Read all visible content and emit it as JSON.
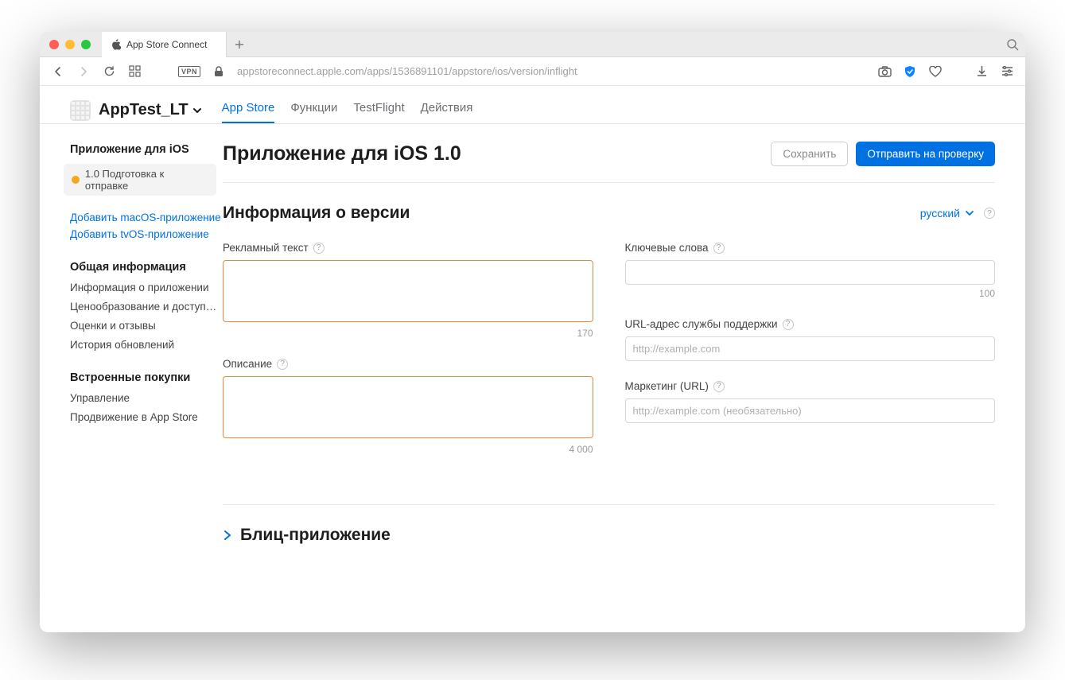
{
  "browser": {
    "tab_title": "App Store Connect",
    "url": "appstoreconnect.apple.com/apps/1536891101/appstore/ios/version/inflight",
    "vpn": "VPN"
  },
  "header": {
    "app_name": "AppTest_LT",
    "tabs": {
      "appstore": "App Store",
      "features": "Функции",
      "testflight": "TestFlight",
      "actions": "Действия"
    }
  },
  "sidebar": {
    "ios_app_title": "Приложение для iOS",
    "version_pill": "1.0 Подготовка к отправке",
    "add_macos": "Добавить macOS-приложение",
    "add_tvos": "Добавить tvOS-приложение",
    "general_title": "Общая информация",
    "items_general": {
      "info": "Информация о приложении",
      "pricing": "Ценообразование и доступно…",
      "ratings": "Оценки и отзывы",
      "history": "История обновлений"
    },
    "iap_title": "Встроенные покупки",
    "items_iap": {
      "manage": "Управление",
      "promote": "Продвижение в App Store"
    }
  },
  "main": {
    "title": "Приложение для iOS 1.0",
    "save": "Сохранить",
    "submit": "Отправить на проверку",
    "section_title": "Информация о версии",
    "language": "русский",
    "fields": {
      "promo_label": "Рекламный текст",
      "promo_count": "170",
      "desc_label": "Описание",
      "desc_count": "4 000",
      "keywords_label": "Ключевые слова",
      "keywords_count": "100",
      "support_label": "URL-адрес службы поддержки",
      "support_placeholder": "http://example.com",
      "marketing_label": "Маркетинг (URL)",
      "marketing_placeholder": "http://example.com (необязательно)"
    },
    "appclip_title": "Блиц-приложение"
  }
}
